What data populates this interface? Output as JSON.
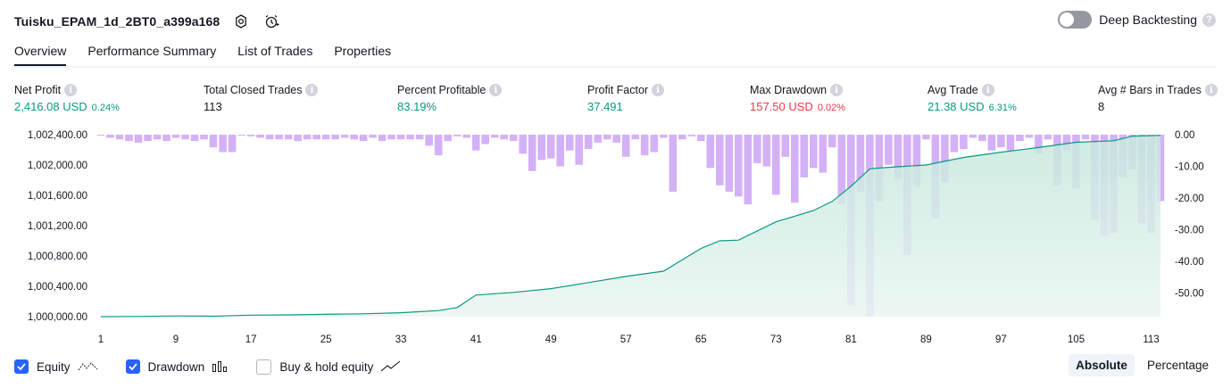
{
  "header": {
    "strategy_name": "Tuisku_EPAM_1d_2BT0_a399a168"
  },
  "deep_backtesting": {
    "label": "Deep Backtesting",
    "enabled": false
  },
  "tabs": [
    {
      "label": "Overview",
      "active": true
    },
    {
      "label": "Performance Summary",
      "active": false
    },
    {
      "label": "List of Trades",
      "active": false
    },
    {
      "label": "Properties",
      "active": false
    }
  ],
  "metrics": {
    "net_profit": {
      "label": "Net Profit",
      "value": "2,416.08 USD",
      "pct": "0.24%"
    },
    "total_closed_trades": {
      "label": "Total Closed Trades",
      "value": "113"
    },
    "percent_profitable": {
      "label": "Percent Profitable",
      "value": "83.19%"
    },
    "profit_factor": {
      "label": "Profit Factor",
      "value": "37.491"
    },
    "max_drawdown": {
      "label": "Max Drawdown",
      "value": "157.50 USD",
      "pct": "0.02%"
    },
    "avg_trade": {
      "label": "Avg Trade",
      "value": "21.38 USD",
      "pct": "6.31%"
    },
    "avg_bars": {
      "label": "Avg # Bars in Trades",
      "value": "8"
    }
  },
  "colors": {
    "equity": "#089981",
    "equity_fill_top": "#c5e8dd",
    "drawdown": "#c99ef5",
    "positive": "#089981",
    "negative": "#f23645",
    "accent": "#2962ff"
  },
  "chart_data": {
    "type": "area",
    "x_ticks": [
      "1",
      "9",
      "17",
      "25",
      "33",
      "41",
      "49",
      "57",
      "65",
      "73",
      "81",
      "89",
      "97",
      "105",
      "113"
    ],
    "y_left_ticks": [
      "1,000,000.00",
      "1,000,400.00",
      "1,000,800.00",
      "1,001,200.00",
      "1,001,600.00",
      "1,002,000.00",
      "1,002,400.00"
    ],
    "y_right_ticks": [
      "0.00",
      "-10.00",
      "-20.00",
      "-30.00",
      "-40.00",
      "-50.00"
    ],
    "ylim_left": [
      1000000,
      1002400
    ],
    "ylim_right": [
      -57.5,
      0
    ],
    "xlim": [
      1,
      114
    ],
    "series": [
      {
        "name": "Equity",
        "x": [
          1,
          5,
          9,
          13,
          17,
          21,
          25,
          29,
          33,
          37,
          39,
          41,
          45,
          49,
          53,
          57,
          61,
          65,
          67,
          69,
          73,
          77,
          79,
          81,
          83,
          85,
          89,
          93,
          97,
          101,
          105,
          109,
          111,
          114
        ],
        "values": [
          1000000,
          1000002,
          1000010,
          1000006,
          1000020,
          1000024,
          1000030,
          1000038,
          1000052,
          1000080,
          1000120,
          1000285,
          1000320,
          1000370,
          1000450,
          1000530,
          1000600,
          1000900,
          1001000,
          1001010,
          1001250,
          1001400,
          1001520,
          1001720,
          1001950,
          1001970,
          1002000,
          1002100,
          1002170,
          1002230,
          1002300,
          1002320,
          1002380,
          1002390
        ]
      },
      {
        "name": "Drawdown",
        "x": [
          1,
          2,
          3,
          4,
          5,
          6,
          7,
          8,
          9,
          10,
          11,
          12,
          13,
          14,
          15,
          16,
          17,
          18,
          19,
          20,
          21,
          22,
          23,
          24,
          25,
          26,
          27,
          28,
          29,
          30,
          31,
          32,
          33,
          34,
          35,
          36,
          37,
          38,
          39,
          40,
          41,
          42,
          43,
          44,
          45,
          46,
          47,
          48,
          49,
          50,
          51,
          52,
          53,
          54,
          55,
          56,
          57,
          58,
          59,
          60,
          61,
          62,
          63,
          64,
          65,
          66,
          67,
          68,
          69,
          70,
          71,
          72,
          73,
          74,
          75,
          76,
          77,
          78,
          79,
          80,
          81,
          82,
          83,
          84,
          85,
          86,
          87,
          88,
          89,
          90,
          91,
          92,
          93,
          94,
          95,
          96,
          97,
          98,
          99,
          100,
          101,
          102,
          103,
          104,
          105,
          106,
          107,
          108,
          109,
          110,
          111,
          112,
          113,
          114
        ],
        "values": [
          0,
          -1,
          -1.5,
          -2,
          -2.5,
          -2,
          -1.5,
          -2,
          -1,
          -1.5,
          -2,
          -1.5,
          -4,
          -5.5,
          -5.5,
          0,
          -0.5,
          -1,
          -1.5,
          -1.5,
          -1.5,
          -2,
          -1.5,
          -1.5,
          -1.5,
          -1.5,
          -1,
          -1.5,
          -2,
          -1,
          -2,
          -1.5,
          -1.5,
          -1.5,
          -1.5,
          -3.5,
          -6.5,
          -2,
          -0.5,
          -1,
          -5,
          -3,
          -1,
          -1.5,
          -2,
          -6,
          -11.5,
          -8,
          -7.5,
          -10,
          -5,
          -9.5,
          -4.5,
          -2.5,
          -1.5,
          -2.5,
          -7,
          -1.5,
          -6.5,
          -5.5,
          -1,
          -18,
          -1.5,
          -0.5,
          -2,
          -10.5,
          -16,
          -18,
          -19.5,
          -22,
          -9,
          -10,
          -19,
          -7,
          -21.5,
          -13.5,
          -10.5,
          -12,
          -4,
          -22,
          -54,
          -18,
          -57.5,
          -21,
          -9.5,
          -14,
          -38,
          -16.5,
          -1.5,
          -26.5,
          -15,
          -5.5,
          -4.5,
          -1,
          -2,
          -5,
          -4,
          -5,
          -2,
          -1,
          -6,
          -1.5,
          -16,
          -5,
          -17,
          -1.5,
          -27,
          -32,
          -31,
          -13.5,
          -11,
          -28,
          -31,
          -21
        ]
      }
    ]
  },
  "footer": {
    "equity": {
      "label": "Equity",
      "checked": true
    },
    "drawdown": {
      "label": "Drawdown",
      "checked": true
    },
    "buy_hold": {
      "label": "Buy & hold equity",
      "checked": false
    },
    "absolute": "Absolute",
    "percentage": "Percentage"
  }
}
